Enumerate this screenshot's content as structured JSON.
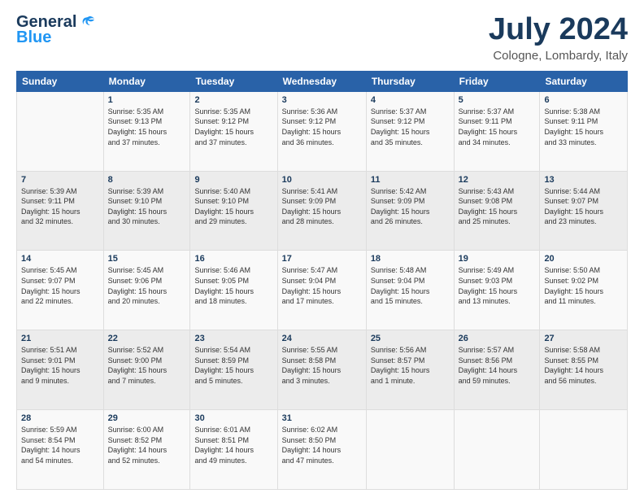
{
  "logo": {
    "line1": "General",
    "line2": "Blue"
  },
  "header": {
    "month": "July 2024",
    "location": "Cologne, Lombardy, Italy"
  },
  "weekdays": [
    "Sunday",
    "Monday",
    "Tuesday",
    "Wednesday",
    "Thursday",
    "Friday",
    "Saturday"
  ],
  "weeks": [
    [
      {
        "day": "",
        "content": ""
      },
      {
        "day": "1",
        "content": "Sunrise: 5:35 AM\nSunset: 9:13 PM\nDaylight: 15 hours\nand 37 minutes."
      },
      {
        "day": "2",
        "content": "Sunrise: 5:35 AM\nSunset: 9:12 PM\nDaylight: 15 hours\nand 37 minutes."
      },
      {
        "day": "3",
        "content": "Sunrise: 5:36 AM\nSunset: 9:12 PM\nDaylight: 15 hours\nand 36 minutes."
      },
      {
        "day": "4",
        "content": "Sunrise: 5:37 AM\nSunset: 9:12 PM\nDaylight: 15 hours\nand 35 minutes."
      },
      {
        "day": "5",
        "content": "Sunrise: 5:37 AM\nSunset: 9:11 PM\nDaylight: 15 hours\nand 34 minutes."
      },
      {
        "day": "6",
        "content": "Sunrise: 5:38 AM\nSunset: 9:11 PM\nDaylight: 15 hours\nand 33 minutes."
      }
    ],
    [
      {
        "day": "7",
        "content": "Sunrise: 5:39 AM\nSunset: 9:11 PM\nDaylight: 15 hours\nand 32 minutes."
      },
      {
        "day": "8",
        "content": "Sunrise: 5:39 AM\nSunset: 9:10 PM\nDaylight: 15 hours\nand 30 minutes."
      },
      {
        "day": "9",
        "content": "Sunrise: 5:40 AM\nSunset: 9:10 PM\nDaylight: 15 hours\nand 29 minutes."
      },
      {
        "day": "10",
        "content": "Sunrise: 5:41 AM\nSunset: 9:09 PM\nDaylight: 15 hours\nand 28 minutes."
      },
      {
        "day": "11",
        "content": "Sunrise: 5:42 AM\nSunset: 9:09 PM\nDaylight: 15 hours\nand 26 minutes."
      },
      {
        "day": "12",
        "content": "Sunrise: 5:43 AM\nSunset: 9:08 PM\nDaylight: 15 hours\nand 25 minutes."
      },
      {
        "day": "13",
        "content": "Sunrise: 5:44 AM\nSunset: 9:07 PM\nDaylight: 15 hours\nand 23 minutes."
      }
    ],
    [
      {
        "day": "14",
        "content": "Sunrise: 5:45 AM\nSunset: 9:07 PM\nDaylight: 15 hours\nand 22 minutes."
      },
      {
        "day": "15",
        "content": "Sunrise: 5:45 AM\nSunset: 9:06 PM\nDaylight: 15 hours\nand 20 minutes."
      },
      {
        "day": "16",
        "content": "Sunrise: 5:46 AM\nSunset: 9:05 PM\nDaylight: 15 hours\nand 18 minutes."
      },
      {
        "day": "17",
        "content": "Sunrise: 5:47 AM\nSunset: 9:04 PM\nDaylight: 15 hours\nand 17 minutes."
      },
      {
        "day": "18",
        "content": "Sunrise: 5:48 AM\nSunset: 9:04 PM\nDaylight: 15 hours\nand 15 minutes."
      },
      {
        "day": "19",
        "content": "Sunrise: 5:49 AM\nSunset: 9:03 PM\nDaylight: 15 hours\nand 13 minutes."
      },
      {
        "day": "20",
        "content": "Sunrise: 5:50 AM\nSunset: 9:02 PM\nDaylight: 15 hours\nand 11 minutes."
      }
    ],
    [
      {
        "day": "21",
        "content": "Sunrise: 5:51 AM\nSunset: 9:01 PM\nDaylight: 15 hours\nand 9 minutes."
      },
      {
        "day": "22",
        "content": "Sunrise: 5:52 AM\nSunset: 9:00 PM\nDaylight: 15 hours\nand 7 minutes."
      },
      {
        "day": "23",
        "content": "Sunrise: 5:54 AM\nSunset: 8:59 PM\nDaylight: 15 hours\nand 5 minutes."
      },
      {
        "day": "24",
        "content": "Sunrise: 5:55 AM\nSunset: 8:58 PM\nDaylight: 15 hours\nand 3 minutes."
      },
      {
        "day": "25",
        "content": "Sunrise: 5:56 AM\nSunset: 8:57 PM\nDaylight: 15 hours\nand 1 minute."
      },
      {
        "day": "26",
        "content": "Sunrise: 5:57 AM\nSunset: 8:56 PM\nDaylight: 14 hours\nand 59 minutes."
      },
      {
        "day": "27",
        "content": "Sunrise: 5:58 AM\nSunset: 8:55 PM\nDaylight: 14 hours\nand 56 minutes."
      }
    ],
    [
      {
        "day": "28",
        "content": "Sunrise: 5:59 AM\nSunset: 8:54 PM\nDaylight: 14 hours\nand 54 minutes."
      },
      {
        "day": "29",
        "content": "Sunrise: 6:00 AM\nSunset: 8:52 PM\nDaylight: 14 hours\nand 52 minutes."
      },
      {
        "day": "30",
        "content": "Sunrise: 6:01 AM\nSunset: 8:51 PM\nDaylight: 14 hours\nand 49 minutes."
      },
      {
        "day": "31",
        "content": "Sunrise: 6:02 AM\nSunset: 8:50 PM\nDaylight: 14 hours\nand 47 minutes."
      },
      {
        "day": "",
        "content": ""
      },
      {
        "day": "",
        "content": ""
      },
      {
        "day": "",
        "content": ""
      }
    ]
  ]
}
